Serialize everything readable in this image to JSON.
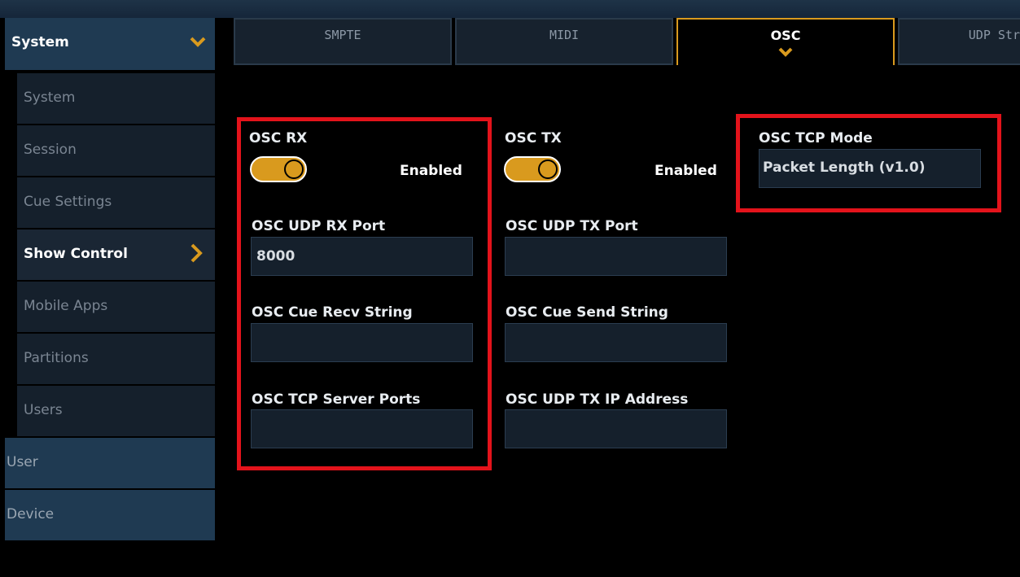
{
  "sidebar": {
    "header": {
      "label": "System",
      "icon": "chevron-down-icon"
    },
    "items": [
      {
        "label": "System"
      },
      {
        "label": "Session"
      },
      {
        "label": "Cue Settings"
      },
      {
        "label": "Show Control",
        "active": true,
        "icon": "chevron-right-icon"
      },
      {
        "label": "Mobile Apps"
      },
      {
        "label": "Partitions"
      },
      {
        "label": "Users"
      }
    ],
    "top_level": [
      {
        "label": "User"
      },
      {
        "label": "Device"
      }
    ]
  },
  "tabs": [
    {
      "label": "SMPTE"
    },
    {
      "label": "MIDI"
    },
    {
      "label": "OSC",
      "active": true
    },
    {
      "label": "UDP Str"
    }
  ],
  "osc_rx": {
    "title": "OSC RX",
    "state": "Enabled",
    "udp_rx_port_label": "OSC UDP RX Port",
    "udp_rx_port_value": "8000",
    "cue_recv_label": "OSC Cue Recv String",
    "cue_recv_value": "",
    "tcp_server_ports_label": "OSC TCP Server Ports",
    "tcp_server_ports_value": ""
  },
  "osc_tx": {
    "title": "OSC TX",
    "state": "Enabled",
    "udp_tx_port_label": "OSC UDP TX Port",
    "udp_tx_port_value": "",
    "cue_send_label": "OSC Cue Send String",
    "cue_send_value": "",
    "udp_tx_ip_label": "OSC UDP TX IP Address",
    "udp_tx_ip_value": ""
  },
  "osc_tcp": {
    "mode_label": "OSC TCP Mode",
    "mode_value": "Packet Length (v1.0)"
  },
  "colors": {
    "accent": "#d99a1e",
    "highlight": "#e3131b",
    "sidebar_header": "#1f3a52",
    "field_bg": "#15202c"
  }
}
